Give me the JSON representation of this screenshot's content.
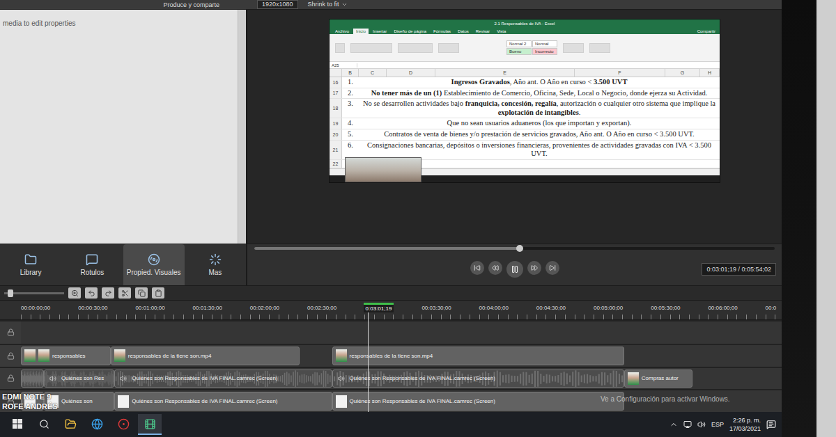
{
  "toolbar": {
    "produce": "Produce y comparte",
    "resolution": "1920x1080",
    "zoom": "Shrink to fit"
  },
  "properties_panel": {
    "hint": "media to edit properties"
  },
  "excel": {
    "title": "2.1 Responsables de IVA - Excel",
    "ribbon_tabs": [
      {
        "label": "Archivo",
        "selected": false
      },
      {
        "label": "Inicio",
        "selected": true
      },
      {
        "label": "Insertar",
        "selected": false
      },
      {
        "label": "Diseño de página",
        "selected": false
      },
      {
        "label": "Fórmulas",
        "selected": false
      },
      {
        "label": "Datos",
        "selected": false
      },
      {
        "label": "Revisar",
        "selected": false
      },
      {
        "label": "Vista",
        "selected": false
      }
    ],
    "share": "Compartir",
    "styles": [
      {
        "label": "Normal 2",
        "color": "#ffffff"
      },
      {
        "label": "Normal",
        "color": "#ffffff"
      },
      {
        "label": "Bueno",
        "color": "#c6efce"
      },
      {
        "label": "Incorrecto",
        "color": "#ffc7ce"
      }
    ],
    "name_box": "A25",
    "columns": [
      "B",
      "C",
      "D",
      "E",
      "F",
      "G",
      "H"
    ],
    "rows": [
      {
        "header": "16",
        "number": "1.",
        "segments": [
          {
            "text": "Ingresos Gravados",
            "bold": true
          },
          {
            "text": ", Año ant. O Año en curso < ",
            "bold": false
          },
          {
            "text": "3.500 UVT",
            "bold": true
          }
        ]
      },
      {
        "header": "17",
        "number": "2.",
        "segments": [
          {
            "text": "No tener más de un (1)",
            "bold": true
          },
          {
            "text": " Establecimiento de Comercio, Oficina, Sede, Local o Negocio, donde ejerza su Actividad.",
            "bold": false
          }
        ]
      },
      {
        "header": "18",
        "number": "3.",
        "segments": [
          {
            "text": "No se desarrollen actividades bajo ",
            "bold": false
          },
          {
            "text": "franquicia, concesión, regalía",
            "bold": true
          },
          {
            "text": ", autorización o cualquier otro sistema que implique la ",
            "bold": false
          },
          {
            "text": "explotación de intangibles",
            "bold": true
          },
          {
            "text": ".",
            "bold": false
          }
        ]
      },
      {
        "header": "19",
        "number": "4.",
        "segments": [
          {
            "text": "Que no sean usuarios aduaneros (los que importan y exportan).",
            "bold": false
          }
        ]
      },
      {
        "header": "20",
        "number": "5.",
        "segments": [
          {
            "text": "Contratos de venta de bienes y/o prestación de servicios gravados, Año ant. O Año en curso < 3.500 UVT.",
            "bold": false
          }
        ]
      },
      {
        "header": "21",
        "number": "6.",
        "segments": [
          {
            "text": "Consignaciones bancarias, depósitos o inversiones financieras, provenientes de actividades gravadas con IVA < 3.500 UVT.",
            "bold": false
          }
        ]
      },
      {
        "header": "22",
        "number": "",
        "segments": []
      }
    ]
  },
  "tabs": [
    {
      "label": "Library",
      "selected": false
    },
    {
      "label": "Rotulos",
      "selected": false
    },
    {
      "label": "Propied. Visuales",
      "selected": true
    },
    {
      "label": "Mas",
      "selected": false
    }
  ],
  "player": {
    "level": 0.51,
    "playing": true,
    "time": "0:03:01;19 / 0:05:54;02"
  },
  "timeline": {
    "zoom_level": 0.1,
    "playhead": {
      "label": "0:03:01;19",
      "time": 181.6
    },
    "ticks": [
      {
        "label": "00:00:00;00",
        "time": 0
      },
      {
        "label": "00:00:30;00",
        "time": 30
      },
      {
        "label": "00:01:00;00",
        "time": 60
      },
      {
        "label": "00:01:30;00",
        "time": 90
      },
      {
        "label": "00:02:00;00",
        "time": 120
      },
      {
        "label": "00:02:30;00",
        "time": 150
      },
      {
        "label": "00:03:30;00",
        "time": 210
      },
      {
        "label": "00:04:00;00",
        "time": 240
      },
      {
        "label": "00:04:30;00",
        "time": 270
      },
      {
        "label": "00:05:00;00",
        "time": 300
      },
      {
        "label": "00:05:30;00",
        "time": 330
      },
      {
        "label": "00:06:00;00",
        "time": 360
      },
      {
        "label": "00:0",
        "time": 390
      }
    ],
    "tracks": [
      {
        "clips": []
      },
      {
        "clips": [
          {
            "kind": "video",
            "label": "responsables",
            "start": 0,
            "end": 47,
            "thumbs": 2
          },
          {
            "kind": "video",
            "label": "responsables de ia tiene son.mp4",
            "start": 47,
            "end": 146,
            "thumbs": 1
          },
          {
            "kind": "video",
            "label": "responsables de la tiene son.mp4",
            "start": 163,
            "end": 316,
            "thumbs": 1
          }
        ]
      },
      {
        "clips": [
          {
            "kind": "audio",
            "label": "",
            "start": 0,
            "end": 12,
            "thumbs": 0
          },
          {
            "kind": "audio",
            "label": "Quiénes son Res",
            "start": 12,
            "end": 49,
            "thumbs": 1
          },
          {
            "kind": "audio",
            "label": "Quiénes son Responsables de IVA FINAL.camrec (Screen)",
            "start": 49,
            "end": 163,
            "thumbs": 1
          },
          {
            "kind": "audio",
            "label": "Quiénes son Responsables de IVA FINAL.camrec (Screen)",
            "start": 163,
            "end": 316,
            "thumbs": 1
          },
          {
            "kind": "video",
            "label": "Compras autor",
            "start": 316,
            "end": 352,
            "thumbs": 1
          }
        ]
      },
      {
        "clips": [
          {
            "kind": "screen",
            "label": "",
            "start": 0,
            "end": 12,
            "thumbs": 1
          },
          {
            "kind": "screen",
            "label": "Quiénes son",
            "start": 12,
            "end": 49,
            "thumbs": 1
          },
          {
            "kind": "screen",
            "label": "Quiénes son Responsables de IVA FINAL.camrec (Screen)",
            "start": 49,
            "end": 163,
            "thumbs": 1
          },
          {
            "kind": "screen",
            "label": "Quiénes son Responsables de IVA FINAL.camrec (Screen)",
            "start": 163,
            "end": 316,
            "thumbs": 1
          }
        ]
      }
    ]
  },
  "watermarks": {
    "activation": "Ve a Configuración para activar Windows.",
    "camera": [
      "EDMI NOTE 9",
      "ROFE ANDRÉS"
    ]
  },
  "taskbar": {
    "language": "ESP",
    "time": "2:26 p. m.",
    "date": "17/03/2021"
  }
}
